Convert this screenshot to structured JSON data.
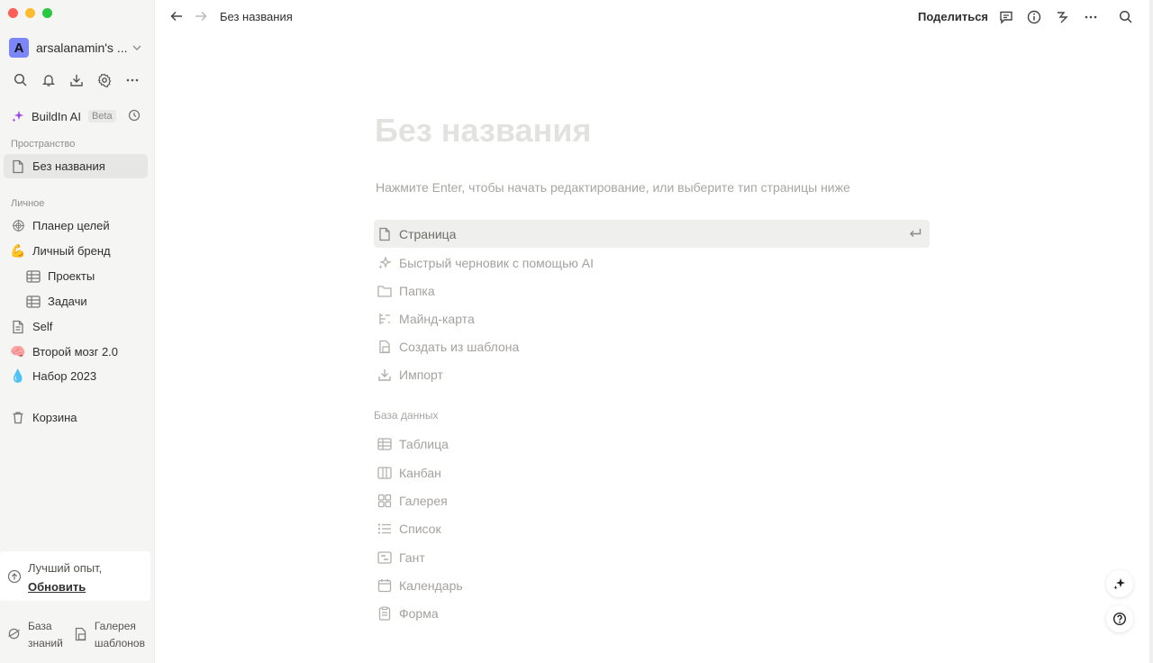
{
  "workspace": {
    "avatar_letter": "A",
    "name": "arsalanamin's ..."
  },
  "ai": {
    "label": "BuildIn AI",
    "badge": "Beta"
  },
  "sidebar": {
    "space_label": "Пространство",
    "space_items": [
      {
        "label": "Без названия",
        "icon": "page-icon"
      }
    ],
    "personal_label": "Личное",
    "personal_items": [
      {
        "label": "Планер целей",
        "icon": "target-icon"
      },
      {
        "label": "Личный бренд",
        "icon": "💪"
      },
      {
        "label": "Проекты",
        "icon": "table-icon"
      },
      {
        "label": "Задачи",
        "icon": "table-icon"
      },
      {
        "label": "Self",
        "icon": "page-icon"
      },
      {
        "label": "Второй мозг 2.0",
        "icon": "🧠"
      },
      {
        "label": "Набор 2023",
        "icon": "💧"
      }
    ],
    "trash": "Корзина"
  },
  "upgrade": {
    "text": "Лучший опыт,",
    "link": "Обновить"
  },
  "bottom": {
    "kb_line1": "База",
    "kb_line2": "знаний",
    "tpl_line1": "Галерея",
    "tpl_line2": "шаблонов"
  },
  "topbar": {
    "breadcrumb": "Без названия",
    "share": "Поделиться"
  },
  "page": {
    "title_placeholder": "Без названия",
    "hint": "Нажмите Enter, чтобы начать редактирование, или выберите тип страницы ниже",
    "options": [
      {
        "label": "Страница",
        "icon": "page-icon"
      },
      {
        "label": "Быстрый черновик с помощью AI",
        "icon": "sparkle-icon"
      },
      {
        "label": "Папка",
        "icon": "folder-icon"
      },
      {
        "label": "Майнд-карта",
        "icon": "mindmap-icon"
      },
      {
        "label": "Создать из шаблона",
        "icon": "template-icon"
      },
      {
        "label": "Импорт",
        "icon": "import-icon"
      }
    ],
    "db_label": "База данных",
    "db_options": [
      {
        "label": "Таблица",
        "icon": "table-icon"
      },
      {
        "label": "Канбан",
        "icon": "kanban-icon"
      },
      {
        "label": "Галерея",
        "icon": "gallery-icon"
      },
      {
        "label": "Список",
        "icon": "list-icon"
      },
      {
        "label": "Гант",
        "icon": "gantt-icon"
      },
      {
        "label": "Календарь",
        "icon": "calendar-icon"
      },
      {
        "label": "Форма",
        "icon": "form-icon"
      }
    ]
  },
  "colors": {
    "accent_ai": "#a04ee0",
    "avatar": "#7b87f7",
    "sidebar_bg": "#f5f5f4"
  }
}
